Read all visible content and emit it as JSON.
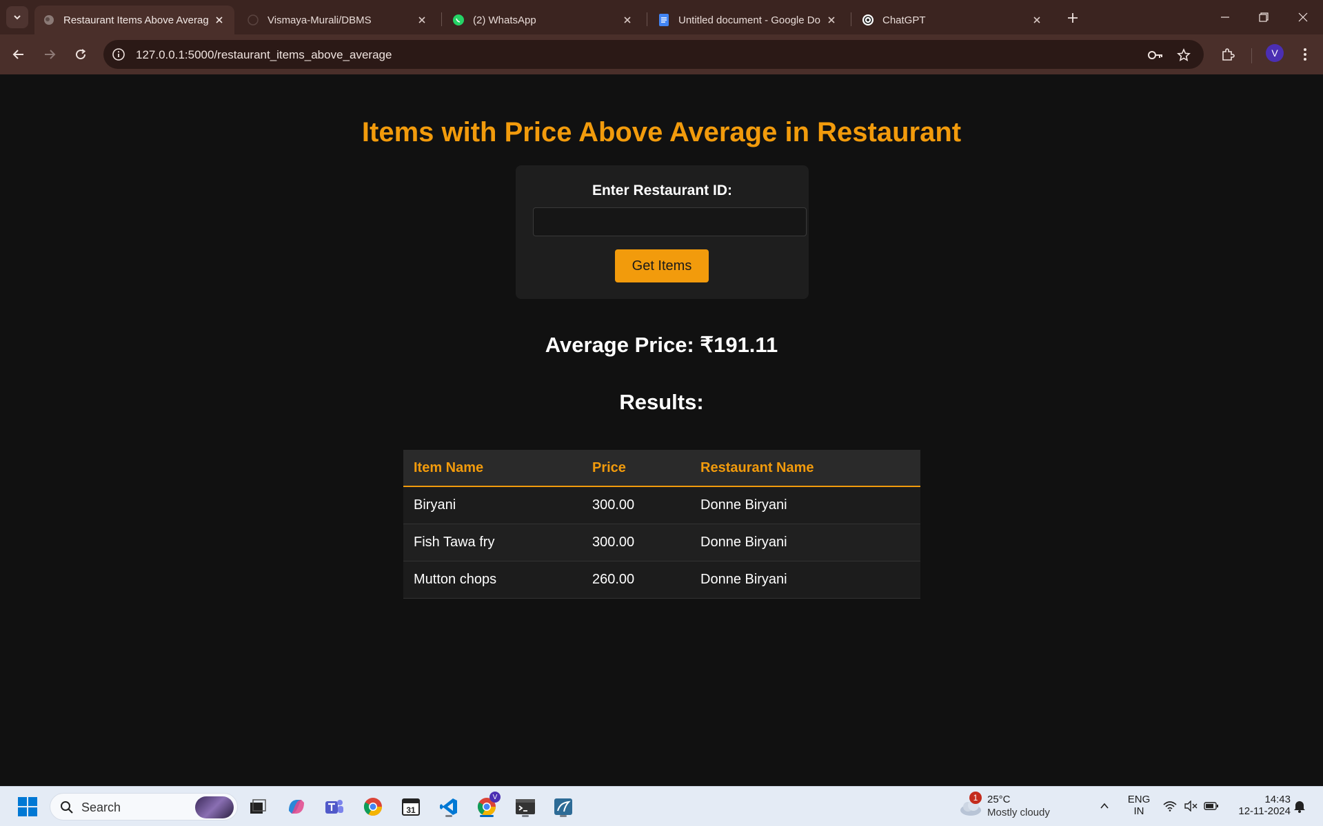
{
  "browser": {
    "tabs": [
      {
        "title": "Restaurant Items Above Averag",
        "active": true
      },
      {
        "title": "Vismaya-Murali/DBMS",
        "active": false
      },
      {
        "title": "(2) WhatsApp",
        "active": false
      },
      {
        "title": "Untitled document - Google Do",
        "active": false
      },
      {
        "title": "ChatGPT",
        "active": false
      }
    ],
    "url": "127.0.0.1:5000/restaurant_items_above_average",
    "profile_initial": "V",
    "accent_color": "#4a2f2a"
  },
  "page": {
    "title": "Items with Price Above Average in Restaurant",
    "form": {
      "label": "Enter Restaurant ID:",
      "input_value": "",
      "button_label": "Get Items"
    },
    "average_price": "Average Price: ₹191.11",
    "results_heading": "Results:",
    "table": {
      "headers": [
        "Item Name",
        "Price",
        "Restaurant Name"
      ],
      "rows": [
        [
          "Biryani",
          "300.00",
          "Donne Biryani"
        ],
        [
          "Fish Tawa fry",
          "300.00",
          "Donne Biryani"
        ],
        [
          "Mutton chops",
          "260.00",
          "Donne Biryani"
        ]
      ]
    },
    "accent_color": "#f29b0c"
  },
  "taskbar": {
    "search_label": "Search",
    "weather": {
      "temp": "25°C",
      "condition": "Mostly cloudy",
      "badge": "1"
    },
    "language": {
      "line1": "ENG",
      "line2": "IN"
    },
    "clock": {
      "time": "14:43",
      "date": "12-11-2024"
    },
    "chrome_badge": "V"
  }
}
